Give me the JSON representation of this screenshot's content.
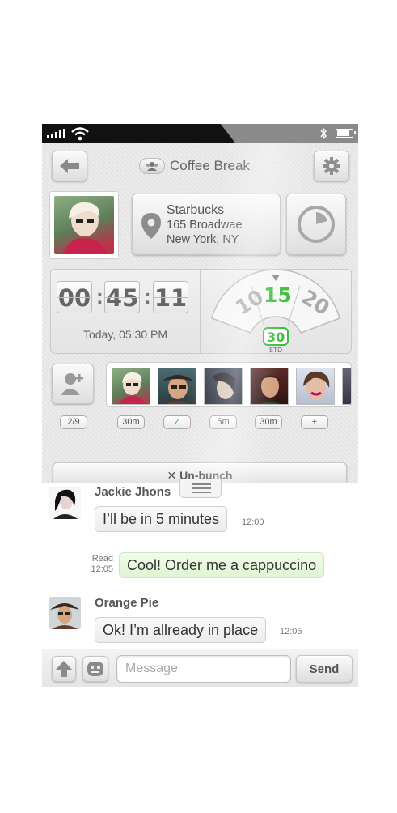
{
  "status_bar": {
    "signal_bars": 5,
    "battery_level": 0.8
  },
  "header": {
    "title": "Coffee Break"
  },
  "location": {
    "name": "Starbucks",
    "address_line1": "165 Broadwae",
    "address_line2": "New York, NY"
  },
  "timer": {
    "hours": "00",
    "minutes": "45",
    "seconds": "11",
    "today_label": "Today, 05:30 PM"
  },
  "dial": {
    "left": "10",
    "center": "15",
    "right": "20",
    "etd_value": "30",
    "etd_label": "ETD"
  },
  "friends": {
    "count_label": "2/9",
    "chips": [
      "30m",
      "✓",
      "5m",
      "30m",
      "+"
    ]
  },
  "unbunch_label": "✕ Un-bunch",
  "chat": {
    "messages": [
      {
        "sender": "Jackie Jhons",
        "text": "I’ll be in 5 minutes",
        "time": "12:00"
      },
      {
        "read_label": "Read",
        "read_time": "12:05",
        "text": "Cool! Order me a cappuccino"
      },
      {
        "sender": "Orange Pie",
        "text": "Ok! I’m allready in place",
        "time": "12:05"
      }
    ]
  },
  "input": {
    "placeholder": "Message",
    "send_label": "Send"
  },
  "colors": {
    "accent_green": "#3bbd3b",
    "dark_bar": "#111111"
  }
}
